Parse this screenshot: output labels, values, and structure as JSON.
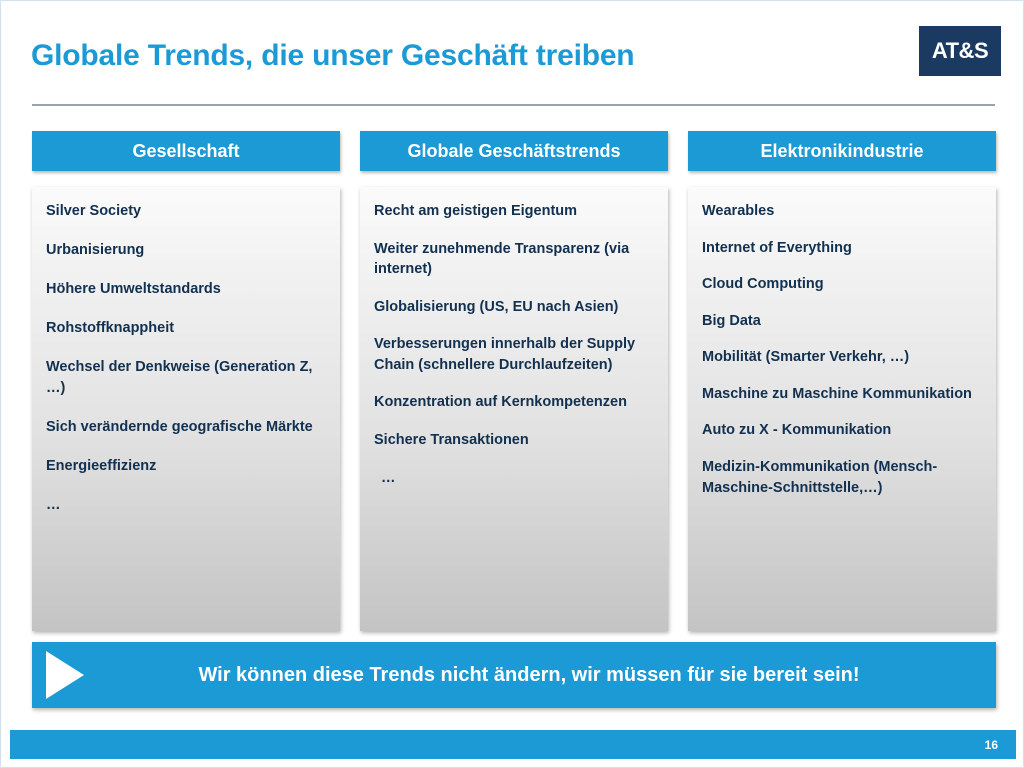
{
  "header": {
    "title": "Globale Trends, die unser Geschäft treiben",
    "logo_text": "AT&S"
  },
  "columns": [
    {
      "heading": "Gesellschaft",
      "items": [
        {
          "text": "Silver Society",
          "indent": false
        },
        {
          "text": "Urbanisierung",
          "indent": false
        },
        {
          "text": "Höhere Umweltstandards",
          "indent": false
        },
        {
          "text": "Rohstoffknappheit",
          "indent": false
        },
        {
          "text": "Wechsel der Denkweise (Generation Z, …)",
          "indent": false
        },
        {
          "text": "Sich verändernde geografische Märkte",
          "indent": false
        },
        {
          "text": "Energieeffizienz",
          "indent": false
        },
        {
          "text": "…",
          "indent": false
        }
      ]
    },
    {
      "heading": "Globale Geschäftstrends",
      "items": [
        {
          "text": "Recht am geistigen Eigentum",
          "indent": false
        },
        {
          "text": "Weiter zunehmende Transparenz (via internet)",
          "indent": false
        },
        {
          "text": "Globalisierung (US, EU nach Asien)",
          "indent": false
        },
        {
          "text": "Verbesserungen innerhalb der Supply Chain (schnellere Durchlaufzeiten)",
          "indent": false
        },
        {
          "text": "Konzentration auf Kernkompetenzen",
          "indent": false
        },
        {
          "text": "Sichere Transaktionen",
          "indent": false
        },
        {
          "text": "…",
          "indent": true
        }
      ]
    },
    {
      "heading": "Elektronikindustrie",
      "items": [
        {
          "text": "Wearables",
          "indent": false
        },
        {
          "text": "Internet of Everything",
          "indent": false
        },
        {
          "text": "Cloud Computing",
          "indent": false
        },
        {
          "text": "Big Data",
          "indent": false
        },
        {
          "text": "Mobilität (Smarter Verkehr, …)",
          "indent": false
        },
        {
          "text": "Maschine zu Maschine Kommunikation",
          "indent": false
        },
        {
          "text": "Auto zu  X - Kommunikation",
          "indent": false
        },
        {
          "text": "Medizin-Kommunikation (Mensch-Maschine-Schnittstelle,…)",
          "indent": false
        }
      ]
    }
  ],
  "banner": {
    "icon": "play-arrow-icon",
    "text": "Wir können diese Trends nicht ändern, wir müssen für sie bereit sein!"
  },
  "footer": {
    "page_number": "16"
  },
  "colors": {
    "accent_blue": "#1b9ad6",
    "logo_navy": "#1b3a62",
    "body_text_navy": "#12304f",
    "divider_gray": "#9aa3ab"
  }
}
